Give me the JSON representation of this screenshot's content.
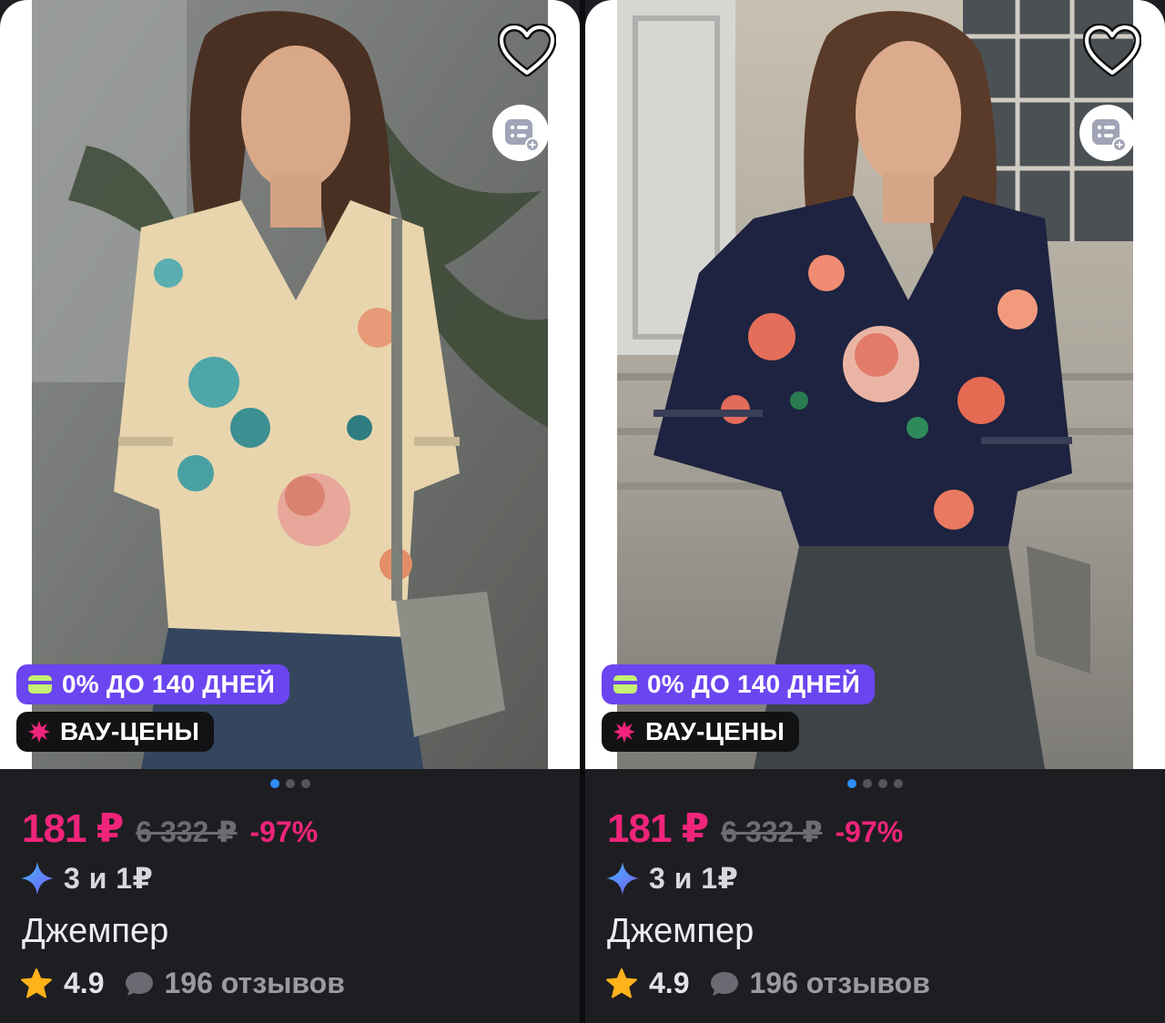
{
  "products": [
    {
      "badges": {
        "installment": "0% ДО 140 ДНЕЙ",
        "wow": "ВАУ-ЦЕНЫ"
      },
      "price": "181 ₽",
      "old_price": "6 332 ₽",
      "discount": "-97%",
      "promo": "3 и 1₽",
      "title": "Джемпер",
      "rating": "4.9",
      "reviews": "196 отзывов",
      "carousel": {
        "pages": 3,
        "active": 1
      },
      "blouse_color": "#e8d5ad"
    },
    {
      "badges": {
        "installment": "0% ДО 140 ДНЕЙ",
        "wow": "ВАУ-ЦЕНЫ"
      },
      "price": "181 ₽",
      "old_price": "6 332 ₽",
      "discount": "-97%",
      "promo": "3 и 1₽",
      "title": "Джемпер",
      "rating": "4.9",
      "reviews": "196 отзывов",
      "carousel": {
        "pages": 4,
        "active": 1
      },
      "blouse_color": "#1d2340"
    }
  ],
  "colors": {
    "price_accent": "#f0247a",
    "installment_badge": "#6b45f0",
    "dot_active": "#2e8df6",
    "card_background": "#1e1e22"
  },
  "icons": {
    "favorite": "heart-outline-icon",
    "add_to_cart": "cart-add-icon",
    "installment": "card-icon",
    "wow": "burst-icon",
    "promo": "sparkle-icon",
    "rating": "star-icon",
    "reviews": "chat-bubble-icon"
  }
}
